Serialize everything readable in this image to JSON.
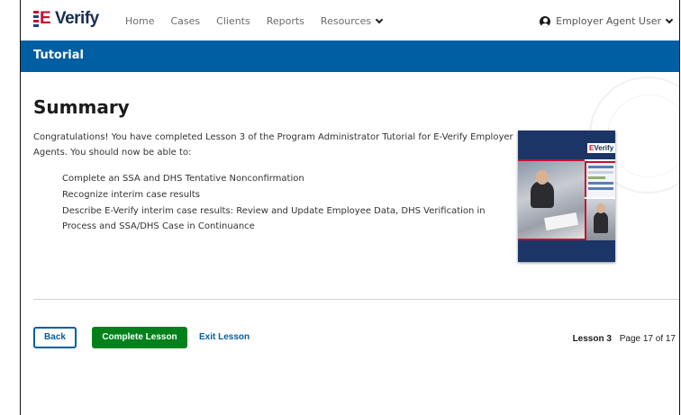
{
  "nav": {
    "logo_prefix": "E",
    "logo_suffix": " Verify",
    "links": [
      "Home",
      "Cases",
      "Clients",
      "Reports",
      "Resources"
    ],
    "user_label": "Employer Agent User"
  },
  "tutorial_bar": {
    "title": "Tutorial"
  },
  "content": {
    "title": "Summary",
    "intro": "Congratulations! You have completed Lesson 3 of the Program Administrator Tutorial for E-Verify Employer Agents. You should now be able to:",
    "objectives": [
      "Complete an SSA and DHS Tentative Nonconfirmation",
      "Recognize interim case results",
      "Describe E-Verify interim case results: Review and Update Employee Data, DHS Verification in Process and SSA/DHS Case in Continuance"
    ],
    "cover_logo_prefix": "E",
    "cover_logo_suffix": "Verify"
  },
  "footer": {
    "back_label": "Back",
    "complete_label": "Complete Lesson",
    "exit_label": "Exit Lesson",
    "lesson_label": "Lesson 3",
    "page_label": "Page 17 of 17"
  },
  "colors": {
    "primary_blue": "#005ea2",
    "brand_navy": "#162e51",
    "brand_red": "#c8102e",
    "success_green": "#00811c"
  },
  "icons": {
    "resources_menu": "chevron-down-icon",
    "user": "user-circle-icon",
    "user_menu": "chevron-down-icon"
  }
}
